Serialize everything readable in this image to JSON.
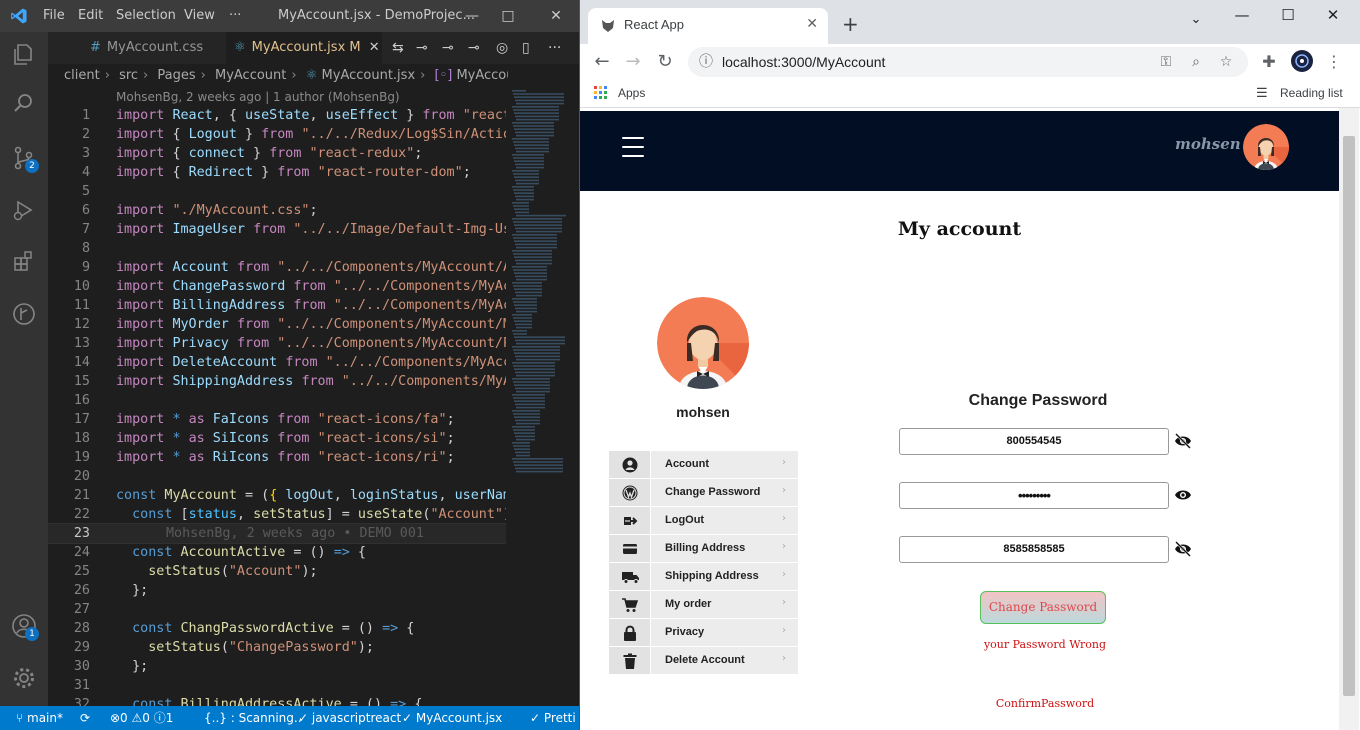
{
  "vscode": {
    "menu": [
      "File",
      "Edit",
      "Selection",
      "View",
      "···"
    ],
    "window_title": "MyAccount.jsx - DemoProjec...",
    "tabs": [
      {
        "label": "MyAccount.css",
        "active": false
      },
      {
        "label": "MyAccount.jsx",
        "modified": "M",
        "active": true
      }
    ],
    "breadcrumb": [
      "client",
      "src",
      "Pages",
      "MyAccount",
      "MyAccount.jsx",
      "MyAccount"
    ],
    "blame_header": "MohsenBg, 2 weeks ago | 1 author (MohsenBg)",
    "current_line_blame": "MohsenBg, 2 weeks ago • DEMO 001",
    "badges": {
      "source_control": "2",
      "accounts": "1"
    },
    "status": {
      "branch": "main*",
      "problems": "⊗0 ⚠0 ⓘ1",
      "scanning": "{..} : Scanning..",
      "language": "✓ javascriptreact",
      "file": "✓ MyAccount.jsx",
      "prettier": "✓ Pretti"
    },
    "lines": [
      {
        "n": "1",
        "tokens": [
          [
            "kw",
            "import "
          ],
          [
            "vr",
            "React"
          ],
          [
            "pl",
            ", { "
          ],
          [
            "vr",
            "useState"
          ],
          [
            "pl",
            ", "
          ],
          [
            "vr",
            "useEffect"
          ],
          [
            "pl",
            " } "
          ],
          [
            "kw",
            "from "
          ],
          [
            "st",
            "\"react\""
          ],
          [
            "pl",
            ";"
          ]
        ]
      },
      {
        "n": "2",
        "tokens": [
          [
            "kw",
            "import "
          ],
          [
            "pl",
            "{ "
          ],
          [
            "vr",
            "Logout"
          ],
          [
            "pl",
            " } "
          ],
          [
            "kw",
            "from "
          ],
          [
            "st",
            "\"../../Redux/Log$Sin/Action/"
          ]
        ]
      },
      {
        "n": "3",
        "tokens": [
          [
            "kw",
            "import "
          ],
          [
            "pl",
            "{ "
          ],
          [
            "vr",
            "connect"
          ],
          [
            "pl",
            " } "
          ],
          [
            "kw",
            "from "
          ],
          [
            "st",
            "\"react-redux\""
          ],
          [
            "pl",
            ";"
          ]
        ]
      },
      {
        "n": "4",
        "tokens": [
          [
            "kw",
            "import "
          ],
          [
            "pl",
            "{ "
          ],
          [
            "vr",
            "Redirect"
          ],
          [
            "pl",
            " } "
          ],
          [
            "kw",
            "from "
          ],
          [
            "st",
            "\"react-router-dom\""
          ],
          [
            "pl",
            ";"
          ]
        ]
      },
      {
        "n": "5",
        "tokens": []
      },
      {
        "n": "6",
        "tokens": [
          [
            "kw",
            "import "
          ],
          [
            "st",
            "\"./MyAccount.css\""
          ],
          [
            "pl",
            ";"
          ]
        ]
      },
      {
        "n": "7",
        "tokens": [
          [
            "kw",
            "import "
          ],
          [
            "vr",
            "ImageUser "
          ],
          [
            "kw",
            "from "
          ],
          [
            "st",
            "\"../../Image/Default-Img-User"
          ]
        ]
      },
      {
        "n": "8",
        "tokens": []
      },
      {
        "n": "9",
        "tokens": [
          [
            "kw",
            "import "
          ],
          [
            "vr",
            "Account "
          ],
          [
            "kw",
            "from "
          ],
          [
            "st",
            "\"../../Components/MyAccount/Acc"
          ]
        ]
      },
      {
        "n": "10",
        "tokens": [
          [
            "kw",
            "import "
          ],
          [
            "vr",
            "ChangePassword "
          ],
          [
            "kw",
            "from "
          ],
          [
            "st",
            "\"../../Components/MyAcco"
          ]
        ]
      },
      {
        "n": "11",
        "tokens": [
          [
            "kw",
            "import "
          ],
          [
            "vr",
            "BillingAddress "
          ],
          [
            "kw",
            "from "
          ],
          [
            "st",
            "\"../../Components/MyAcco"
          ]
        ]
      },
      {
        "n": "12",
        "tokens": [
          [
            "kw",
            "import "
          ],
          [
            "vr",
            "MyOrder "
          ],
          [
            "kw",
            "from "
          ],
          [
            "st",
            "\"../../Components/MyAccount/My"
          ]
        ]
      },
      {
        "n": "13",
        "tokens": [
          [
            "kw",
            "import "
          ],
          [
            "vr",
            "Privacy "
          ],
          [
            "kw",
            "from "
          ],
          [
            "st",
            "\"../../Components/MyAccount/Pri"
          ]
        ]
      },
      {
        "n": "14",
        "tokens": [
          [
            "kw",
            "import "
          ],
          [
            "vr",
            "DeleteAccount "
          ],
          [
            "kw",
            "from "
          ],
          [
            "st",
            "\"../../Components/MyAccou"
          ]
        ]
      },
      {
        "n": "15",
        "tokens": [
          [
            "kw",
            "import "
          ],
          [
            "vr",
            "ShippingAddress "
          ],
          [
            "kw",
            "from "
          ],
          [
            "st",
            "\"../../Components/MyAco"
          ]
        ]
      },
      {
        "n": "16",
        "tokens": []
      },
      {
        "n": "17",
        "tokens": [
          [
            "kw",
            "import "
          ],
          [
            "ty",
            "* "
          ],
          [
            "kw",
            "as "
          ],
          [
            "vr",
            "FaIcons "
          ],
          [
            "kw",
            "from "
          ],
          [
            "st",
            "\"react-icons/fa\""
          ],
          [
            "pl",
            ";"
          ]
        ]
      },
      {
        "n": "18",
        "tokens": [
          [
            "kw",
            "import "
          ],
          [
            "ty",
            "* "
          ],
          [
            "kw",
            "as "
          ],
          [
            "vr",
            "SiIcons "
          ],
          [
            "kw",
            "from "
          ],
          [
            "st",
            "\"react-icons/si\""
          ],
          [
            "pl",
            ";"
          ]
        ]
      },
      {
        "n": "19",
        "tokens": [
          [
            "kw",
            "import "
          ],
          [
            "ty",
            "* "
          ],
          [
            "kw",
            "as "
          ],
          [
            "vr",
            "RiIcons "
          ],
          [
            "kw",
            "from "
          ],
          [
            "st",
            "\"react-icons/ri\""
          ],
          [
            "pl",
            ";"
          ]
        ]
      },
      {
        "n": "20",
        "tokens": []
      },
      {
        "n": "21",
        "tokens": [
          [
            "ty",
            "const "
          ],
          [
            "fn",
            "MyAccount "
          ],
          [
            "pl",
            "= ("
          ],
          [
            "br",
            "{ "
          ],
          [
            "vr",
            "logOut"
          ],
          [
            "pl",
            ", "
          ],
          [
            "vr",
            "loginStatus"
          ],
          [
            "pl",
            ", "
          ],
          [
            "vr",
            "userName"
          ]
        ]
      },
      {
        "n": "22",
        "tokens": [
          [
            "pl",
            "  "
          ],
          [
            "ty",
            "const "
          ],
          [
            "pl",
            "["
          ],
          [
            "cn",
            "status"
          ],
          [
            "pl",
            ", "
          ],
          [
            "fn",
            "setStatus"
          ],
          [
            "pl",
            "] = "
          ],
          [
            "fn",
            "useState"
          ],
          [
            "pl",
            "("
          ],
          [
            "st",
            "\"Account\""
          ],
          [
            "pl",
            ");"
          ]
        ]
      },
      {
        "n": "23",
        "tokens": [],
        "current": true
      },
      {
        "n": "24",
        "tokens": [
          [
            "pl",
            "  "
          ],
          [
            "ty",
            "const "
          ],
          [
            "fn",
            "AccountActive "
          ],
          [
            "pl",
            "= () "
          ],
          [
            "ty",
            "=> "
          ],
          [
            "pl",
            "{"
          ]
        ]
      },
      {
        "n": "25",
        "tokens": [
          [
            "pl",
            "    "
          ],
          [
            "fn",
            "setStatus"
          ],
          [
            "pl",
            "("
          ],
          [
            "st",
            "\"Account\""
          ],
          [
            "pl",
            ");"
          ]
        ]
      },
      {
        "n": "26",
        "tokens": [
          [
            "pl",
            "  };"
          ]
        ]
      },
      {
        "n": "27",
        "tokens": []
      },
      {
        "n": "28",
        "tokens": [
          [
            "pl",
            "  "
          ],
          [
            "ty",
            "const "
          ],
          [
            "fn",
            "ChangPasswordActive "
          ],
          [
            "pl",
            "= () "
          ],
          [
            "ty",
            "=> "
          ],
          [
            "pl",
            "{"
          ]
        ]
      },
      {
        "n": "29",
        "tokens": [
          [
            "pl",
            "    "
          ],
          [
            "fn",
            "setStatus"
          ],
          [
            "pl",
            "("
          ],
          [
            "st",
            "\"ChangePassword\""
          ],
          [
            "pl",
            ");"
          ]
        ]
      },
      {
        "n": "30",
        "tokens": [
          [
            "pl",
            "  };"
          ]
        ]
      },
      {
        "n": "31",
        "tokens": []
      },
      {
        "n": "32",
        "tokens": [
          [
            "pl",
            "  "
          ],
          [
            "ty",
            "const "
          ],
          [
            "fn",
            "BillingAddressActive "
          ],
          [
            "pl",
            "= () "
          ],
          [
            "ty",
            "=> "
          ],
          [
            "pl",
            "{"
          ]
        ]
      }
    ]
  },
  "chrome": {
    "tab_title": "React App",
    "url": "localhost:3000/MyAccount",
    "bookmarks_apps": "Apps",
    "reading_list": "Reading list"
  },
  "app": {
    "nav_username": "mohsen",
    "page_title": "My account",
    "side_name": "mohsen",
    "menu": [
      {
        "label": "Account",
        "icon": "user-circle-icon"
      },
      {
        "label": "Change Password",
        "icon": "wordpress-icon"
      },
      {
        "label": "LogOut",
        "icon": "logout-icon"
      },
      {
        "label": "Billing Address",
        "icon": "credit-card-icon"
      },
      {
        "label": "Shipping Address",
        "icon": "truck-icon"
      },
      {
        "label": "My order",
        "icon": "cart-icon"
      },
      {
        "label": "Privacy",
        "icon": "lock-icon"
      },
      {
        "label": "Delete Account",
        "icon": "trash-icon"
      }
    ],
    "form": {
      "title": "Change Password",
      "current_password": "800554545",
      "new_password": "•••••••••",
      "confirm_password": "8585858585",
      "button": "Change Password",
      "error_password": "your Password Wrong",
      "error_confirm": "ConfirmPassword"
    }
  },
  "colors": {
    "vscode_statusbar": "#007acc",
    "navbar": "#020e24",
    "error": "#cc1111",
    "button_border": "#57c05a"
  }
}
